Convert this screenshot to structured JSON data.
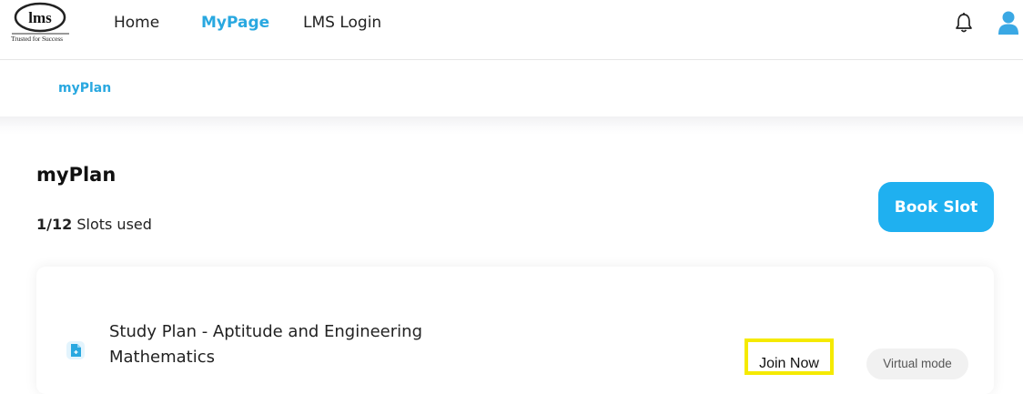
{
  "header": {
    "logo_text": "lms",
    "logo_tagline": "Trusted for Success",
    "nav": [
      {
        "label": "Home"
      },
      {
        "label": "MyPage"
      },
      {
        "label": "LMS Login"
      }
    ],
    "icons": {
      "notifications": "bell-icon",
      "profile": "user-icon"
    }
  },
  "subnav": {
    "tab_label": "myPlan"
  },
  "main": {
    "title": "myPlan",
    "slots": {
      "used": "1/12",
      "label": "Slots used"
    },
    "book_slot_label": "Book Slot"
  },
  "plan_card": {
    "title": "Study Plan - Aptitude and Engineering Mathematics",
    "join_label": "Join Now",
    "mode_label": "Virtual mode"
  },
  "colors": {
    "accent": "#29a8e0",
    "button": "#1fb0f0",
    "highlight": "#f5ea00",
    "badge_bg": "#f1f1f1"
  }
}
